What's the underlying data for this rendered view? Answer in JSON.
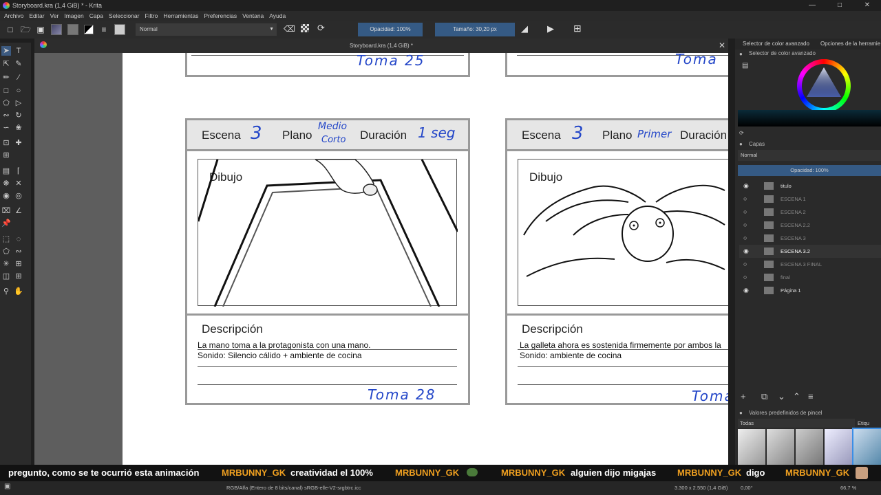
{
  "window": {
    "title": "Storyboard.kra (1,4 GiB) * - Krita"
  },
  "menu": [
    "Archivo",
    "Editar",
    "Ver",
    "Imagen",
    "Capa",
    "Seleccionar",
    "Filtro",
    "Herramientas",
    "Preferencias",
    "Ventana",
    "Ayuda"
  ],
  "toolbar": {
    "blend_mode": "Normal",
    "opacity": "Opacidad: 100%",
    "size": "Tamaño: 30,20 px"
  },
  "document_tab": "Storyboard.kra (1,4 GiB) *",
  "storyboard": {
    "toma_top_left": "Toma 25",
    "toma_top_right": "Toma",
    "panel_left": {
      "escena_label": "Escena",
      "escena_value": "3",
      "plano_label": "Plano",
      "plano_value_1": "Medio",
      "plano_value_2": "Corto",
      "duracion_label": "Duración",
      "duracion_value": "1 seg",
      "dibujo_label": "Dibujo",
      "descripcion_label": "Descripción",
      "desc_line1": "La mano toma a la protagonista con una mano.",
      "desc_line2": "Sonido: Silencio cálido + ambiente de cocina",
      "toma": "Toma 28"
    },
    "panel_right": {
      "escena_label": "Escena",
      "escena_value": "3",
      "plano_label": "Plano",
      "plano_value": "Primer",
      "duracion_label": "Duración",
      "dibujo_label": "Dibujo",
      "descripcion_label": "Descripción",
      "desc_line1": "La galleta ahora es sostenida firmemente por ambos la",
      "desc_line2": "Sonido: ambiente de cocina",
      "toma": "Toma"
    }
  },
  "dock": {
    "tab_color": "Selector de color avanzado",
    "tab_tools": "Opciones de la herramie",
    "color_header": "Selector de color avanzado",
    "layers_header": "Capas",
    "layers_blend": "Normal",
    "layers_opacity": "Opacidad:  100%",
    "layers": [
      {
        "name": "titulo",
        "visible": true,
        "active": false
      },
      {
        "name": "ESCENA 1",
        "visible": false,
        "active": false
      },
      {
        "name": "ESCENA 2",
        "visible": false,
        "active": false
      },
      {
        "name": "ESCENA 2.2",
        "visible": false,
        "active": false
      },
      {
        "name": "ESCENA 3",
        "visible": false,
        "active": false
      },
      {
        "name": "ESCENA 3.2",
        "visible": true,
        "active": true
      },
      {
        "name": "ESCENA 3 FINAL",
        "visible": false,
        "active": false
      },
      {
        "name": "final",
        "visible": false,
        "active": false
      },
      {
        "name": "Página 1",
        "visible": true,
        "active": false
      }
    ],
    "brushes_header": "Valores predefinidos de pincel",
    "brushes_filter": "Todas",
    "brushes_tag": "Etiqu"
  },
  "chat": [
    {
      "user": "",
      "text": "pregunto, como se te ocurrió esta animación"
    },
    {
      "user": "MRBUNNY_GK",
      "text": "creatividad el 100%"
    },
    {
      "user": "MRBUNNY_GK",
      "text": ""
    },
    {
      "user": "MRBUNNY_GK",
      "text": "alguien dijo migajas"
    },
    {
      "user": "MRBUNNY_GK",
      "text": "digo"
    },
    {
      "user": "MRBUNNY_GK",
      "text": ""
    }
  ],
  "status": {
    "color_space": "RGB/Alfa (Entero de 8 bits/canal)  sRGB-elle-V2-srgbtrc.icc",
    "dimensions": "3.300 x 2.550 (1,4 GiB)",
    "rotation": "0,00°",
    "zoom": "66,7 %"
  },
  "colors": {
    "accent": "#355a84",
    "handwriting": "#2346c8",
    "chat_user": "#f0a020"
  }
}
